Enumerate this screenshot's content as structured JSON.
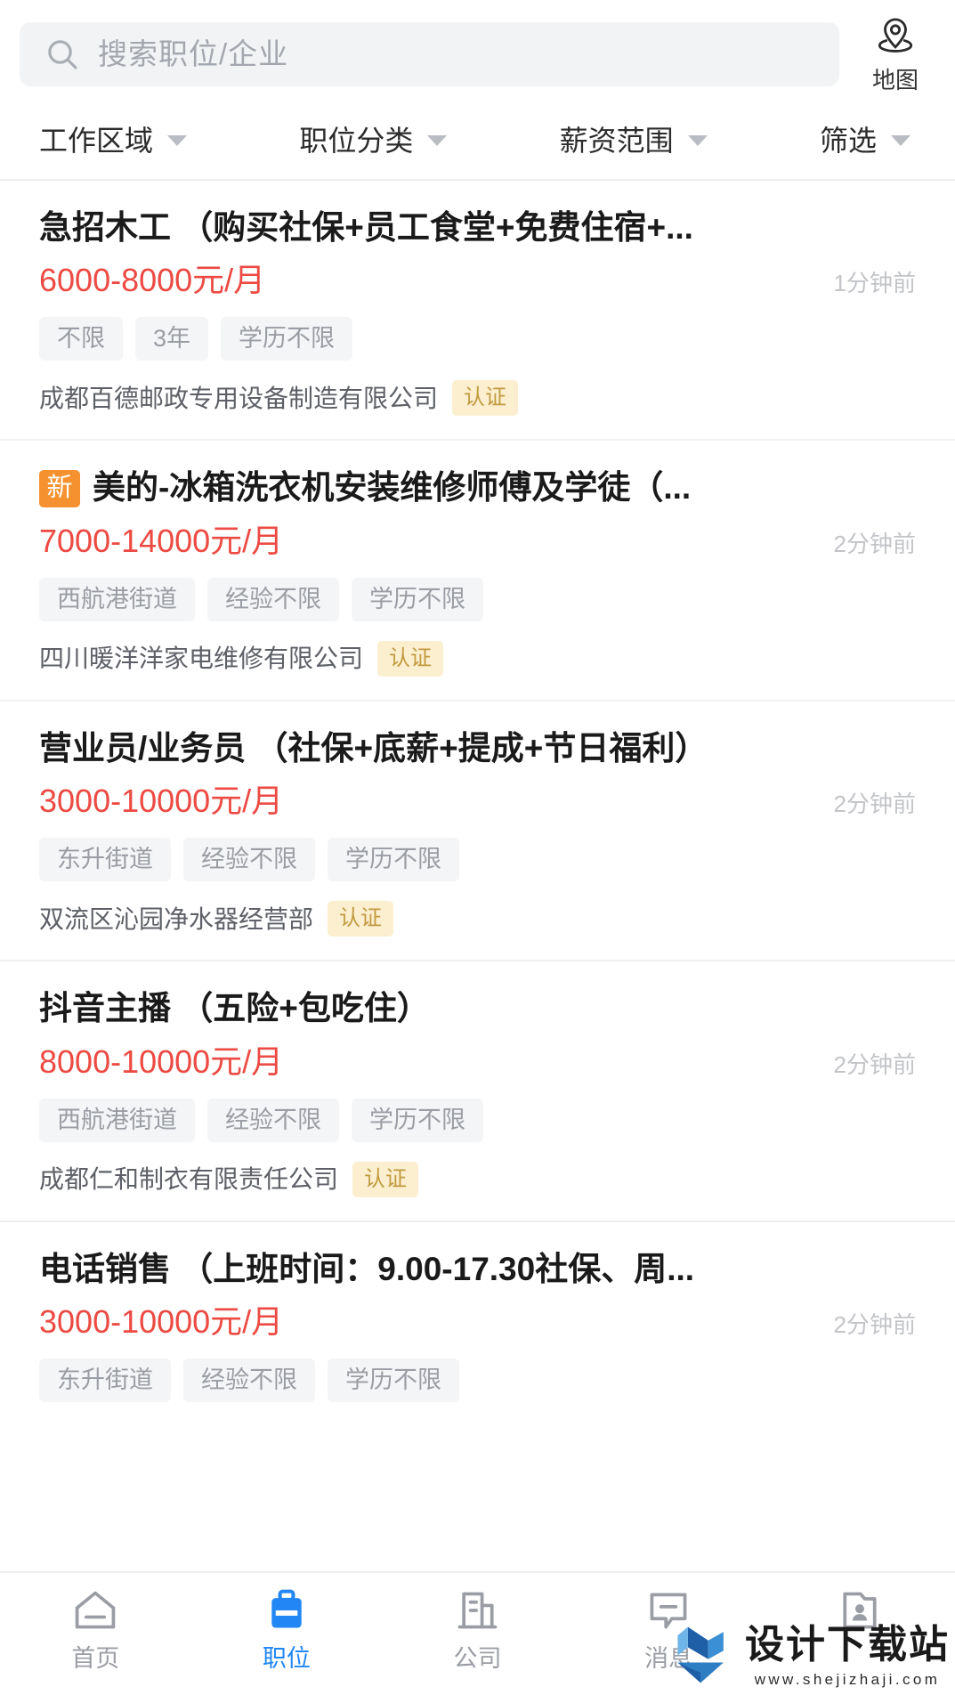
{
  "header": {
    "search": {
      "placeholder": "搜索职位/企业",
      "value": "",
      "icon": "search-icon"
    },
    "map_button": {
      "label": "地图",
      "icon": "location-pin-icon"
    }
  },
  "filters": [
    {
      "label": "工作区域",
      "icon": "chevron-down-icon"
    },
    {
      "label": "职位分类",
      "icon": "chevron-down-icon"
    },
    {
      "label": "薪资范围",
      "icon": "chevron-down-icon"
    },
    {
      "label": "筛选",
      "icon": "chevron-down-icon"
    }
  ],
  "jobs": [
    {
      "badge": "",
      "title": "急招木工 （购买社保+员工食堂+免费住宿+...",
      "salary": "6000-8000元/月",
      "posted": "1分钟前",
      "tags": [
        "不限",
        "3年",
        "学历不限"
      ],
      "company": "成都百德邮政专用设备制造有限公司",
      "verified": "认证"
    },
    {
      "badge": "新",
      "title": "美的-冰箱洗衣机安装维修师傅及学徒（...",
      "salary": "7000-14000元/月",
      "posted": "2分钟前",
      "tags": [
        "西航港街道",
        "经验不限",
        "学历不限"
      ],
      "company": "四川暖洋洋家电维修有限公司",
      "verified": "认证"
    },
    {
      "badge": "",
      "title": "营业员/业务员 （社保+底薪+提成+节日福利）",
      "salary": "3000-10000元/月",
      "posted": "2分钟前",
      "tags": [
        "东升街道",
        "经验不限",
        "学历不限"
      ],
      "company": "双流区沁园净水器经营部",
      "verified": "认证"
    },
    {
      "badge": "",
      "title": "抖音主播 （五险+包吃住）",
      "salary": "8000-10000元/月",
      "posted": "2分钟前",
      "tags": [
        "西航港街道",
        "经验不限",
        "学历不限"
      ],
      "company": "成都仁和制衣有限责任公司",
      "verified": "认证"
    },
    {
      "badge": "",
      "title": "电话销售 （上班时间：9.00-17.30社保、周...",
      "salary": "3000-10000元/月",
      "posted": "2分钟前",
      "tags": [
        "东升街道",
        "经验不限",
        "学历不限"
      ],
      "company": "",
      "verified": ""
    }
  ],
  "tabbar": {
    "items": [
      {
        "label": "首页",
        "icon": "home-icon",
        "active": false
      },
      {
        "label": "职位",
        "icon": "briefcase-icon",
        "active": true
      },
      {
        "label": "公司",
        "icon": "building-icon",
        "active": false
      },
      {
        "label": "消息",
        "icon": "message-bubble-icon",
        "active": false
      },
      {
        "label": "",
        "icon": "profile-card-icon",
        "active": false
      }
    ]
  },
  "watermark": {
    "title": "设计下载站",
    "url": "www.shejizhaji.com",
    "icon": "shejizhaji-logo-icon"
  },
  "colors": {
    "accent_blue": "#2287f5",
    "salary_red": "#ec4a42",
    "new_badge_orange": "#f5922f",
    "verify_bg": "#fbefd0",
    "verify_text": "#c19a3e",
    "tag_bg": "#f4f5f7",
    "search_bg": "#f2f3f5"
  }
}
